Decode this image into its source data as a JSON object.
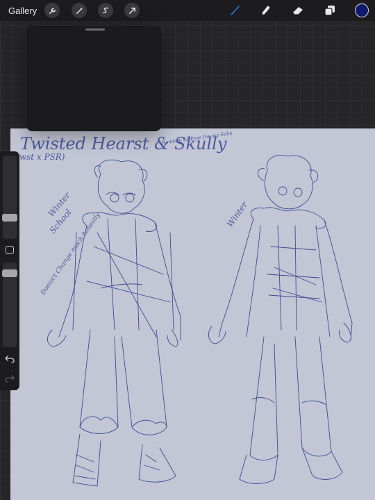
{
  "toolbar": {
    "gallery_label": "Gallery",
    "left_tools": [
      "wrench-icon",
      "wand-icon",
      "selection-icon",
      "transform-icon"
    ],
    "right_tools": [
      "brush-icon",
      "smudge-icon",
      "eraser-icon",
      "layers-icon"
    ],
    "active_color": "#121a6e",
    "brush_active_color": "#2f7bf2"
  },
  "canvas": {
    "title": "Twisted Hearst & Skully",
    "subtitle": "twst x PSR)",
    "side_note": "Random as Pose for my Sake",
    "label_left_1": "Winter",
    "label_left_2": "School",
    "note_left": "Doesn't Change much honestly",
    "label_right": "Winter",
    "ink_color": "#1f2f8a",
    "background_color": "#c3c6d4"
  },
  "sidebar": {
    "brush_size_level": 0.67,
    "opacity_level": 0.93
  }
}
